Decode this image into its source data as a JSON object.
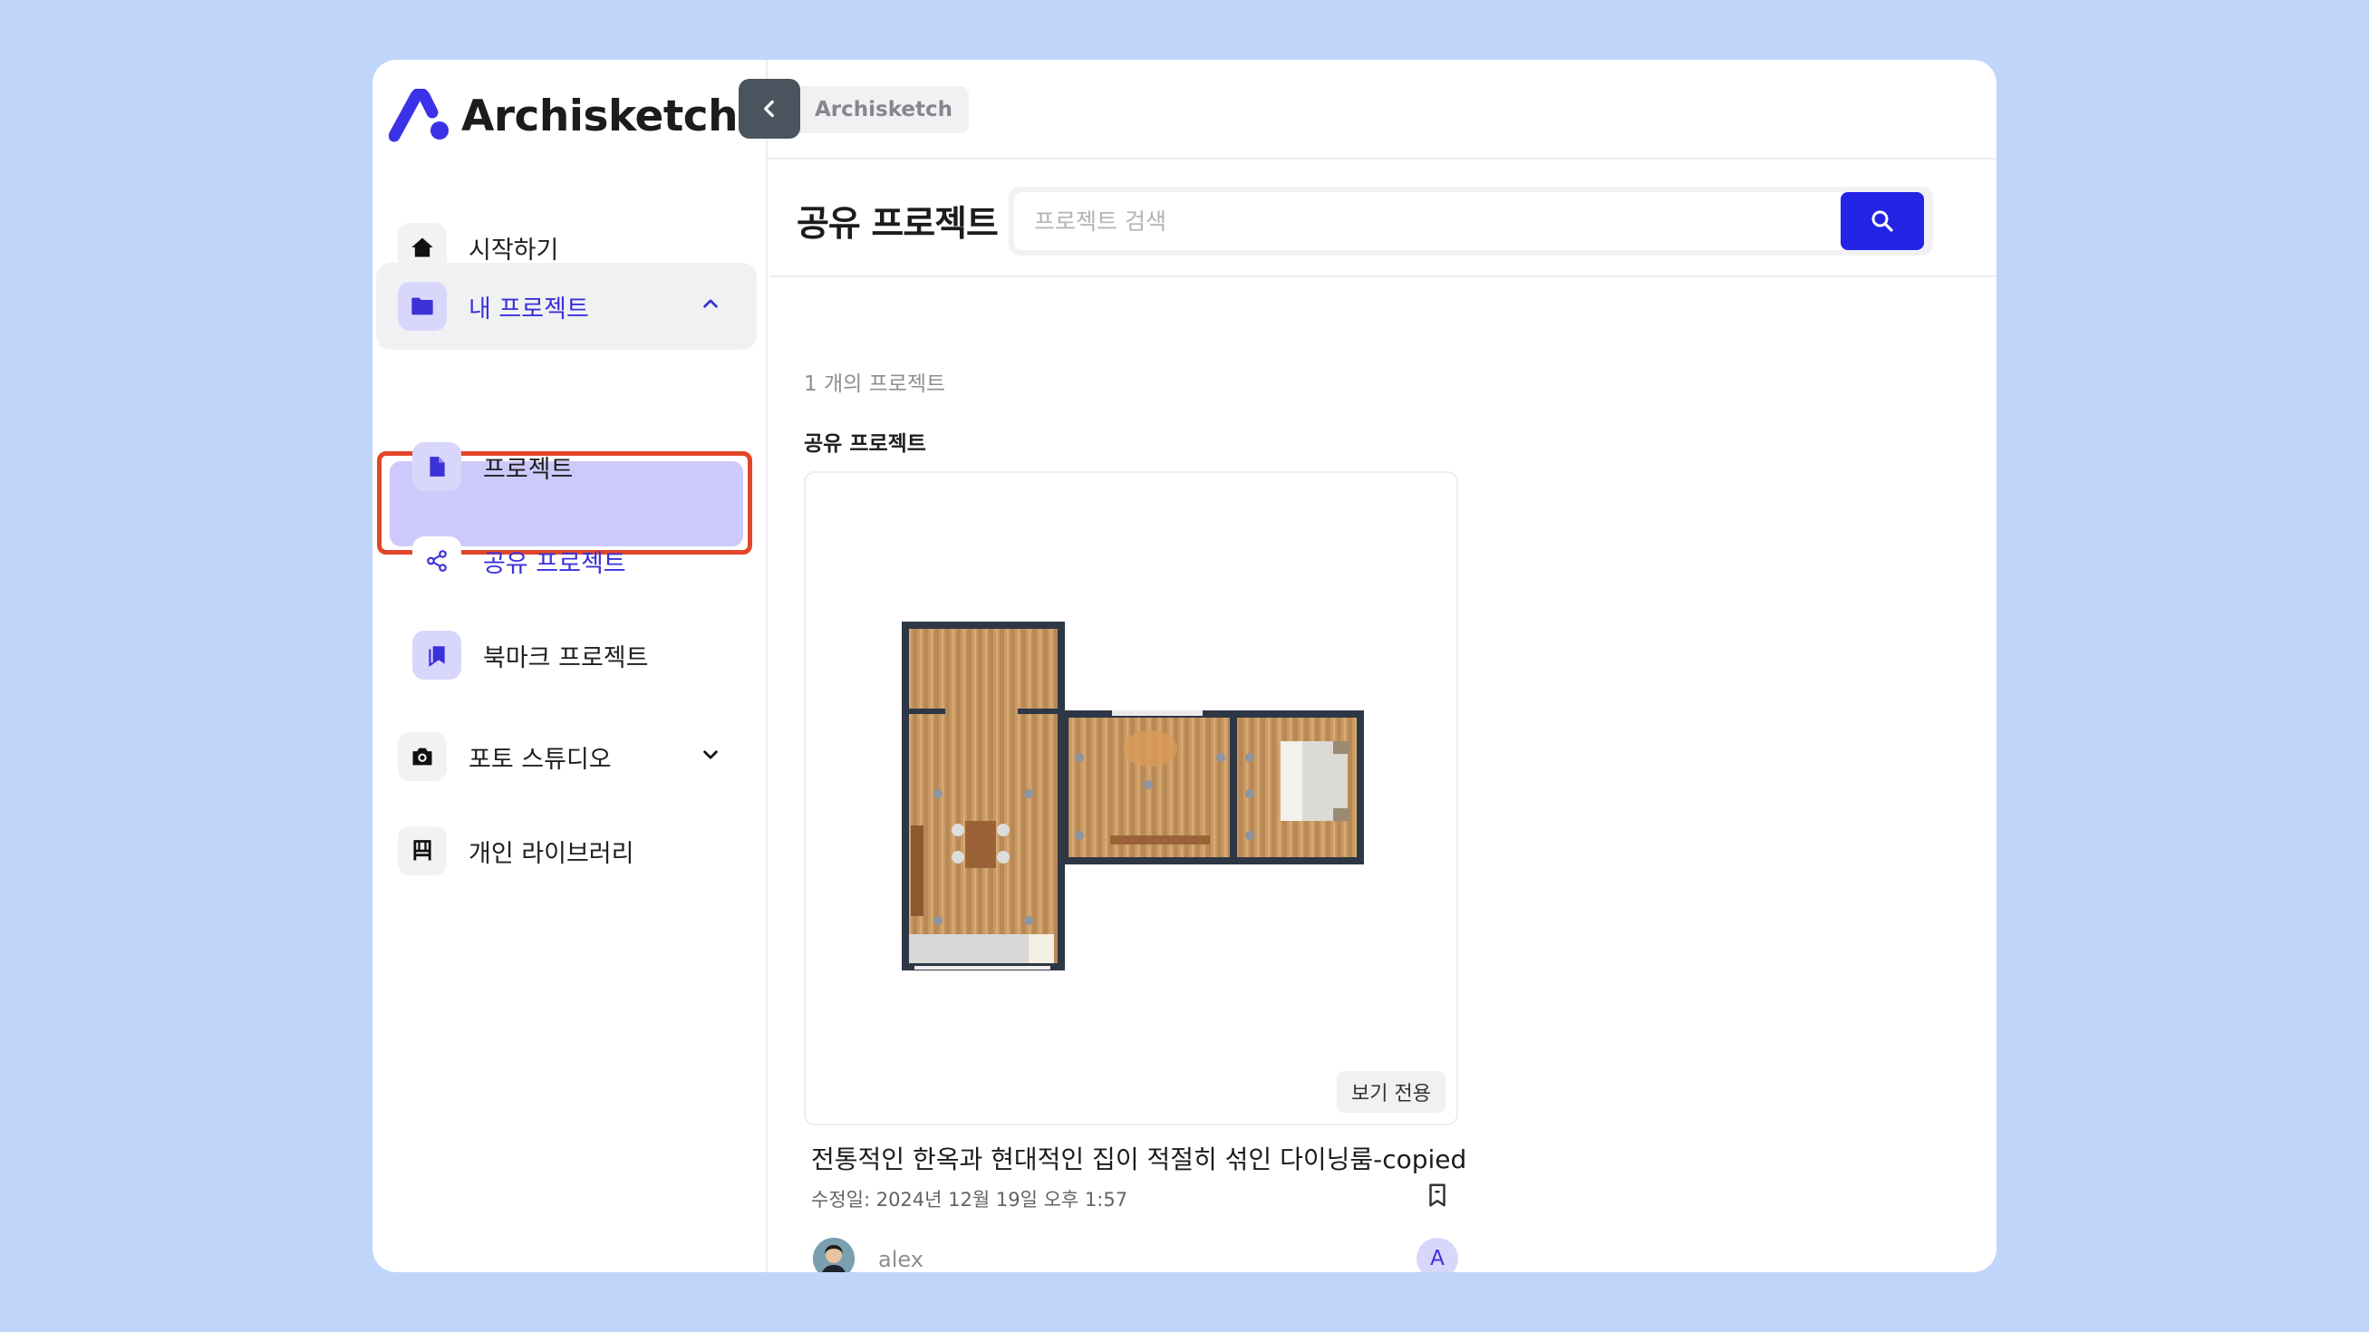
{
  "app": {
    "name": "Archisketch",
    "accent": "#2424e6"
  },
  "breadcrumb": {
    "label": "Archisketch"
  },
  "sidebar": {
    "items": [
      {
        "label": "시작하기",
        "icon": "home-icon"
      },
      {
        "label": "내 프로젝트",
        "icon": "folder-icon",
        "expanded": true
      },
      {
        "label": "프로젝트",
        "icon": "file-icon"
      },
      {
        "label": "공유 프로젝트",
        "icon": "share-icon",
        "active": true
      },
      {
        "label": "북마크 프로젝트",
        "icon": "bookmark-icon"
      },
      {
        "label": "포토 스튜디오",
        "icon": "camera-icon",
        "expanded": false
      },
      {
        "label": "개인 라이브러리",
        "icon": "chair-icon"
      }
    ]
  },
  "main": {
    "title": "공유 프로젝트",
    "search_placeholder": "프로젝트 검색",
    "count_text": "1 개의 프로젝트",
    "section_label": "공유 프로젝트",
    "project": {
      "badge": "보기 전용",
      "title": "전통적인 한옥과 현대적인 집이 적절히 섞인 다이닝룸-copied",
      "modified": "수정일: 2024년 12월 19일 오후 1:57",
      "author": "alex",
      "member_initial": "A"
    }
  }
}
